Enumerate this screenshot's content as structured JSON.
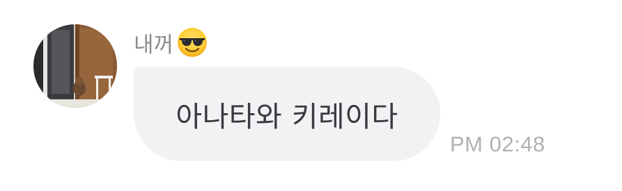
{
  "message": {
    "sender_name": "내꺼",
    "sender_emoji": "smiling-face-with-sunglasses-icon",
    "text": "아나타와 키레이다",
    "timestamp": "PM 02:48"
  },
  "colors": {
    "bubble_background": "#f2f2f5",
    "bubble_text": "#3a3a3e",
    "sender_name": "#8c8c90",
    "timestamp": "#b0b0b6",
    "page_background": "#ffffff"
  }
}
